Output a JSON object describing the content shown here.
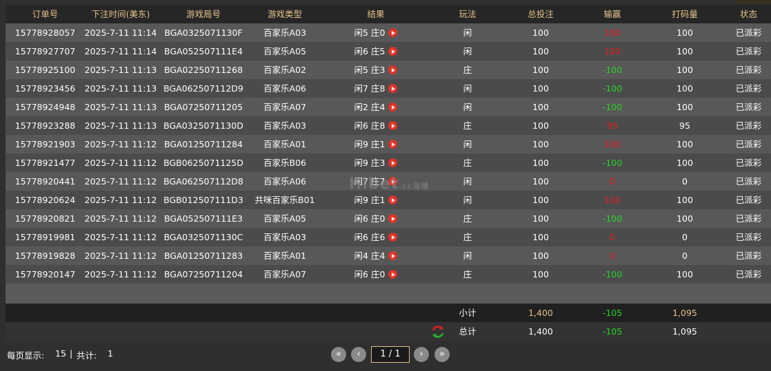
{
  "columns": [
    "订单号",
    "下注时间(美东)",
    "游戏局号",
    "游戏类型",
    "结果",
    "玩法",
    "总投注",
    "输赢",
    "打码量",
    "状态"
  ],
  "rows": [
    {
      "order": "15778928057",
      "time": "2025-7-11 11:14",
      "round": "BGA0325071130F",
      "game": "百家乐A03",
      "result": "闲5 庄0",
      "play": "闲",
      "bet": "100",
      "win": "100",
      "win_color": "red",
      "turnover": "100",
      "status": "已派彩"
    },
    {
      "order": "15778927707",
      "time": "2025-7-11 11:14",
      "round": "BGA052507111E4",
      "game": "百家乐A05",
      "result": "闲6 庄5",
      "play": "闲",
      "bet": "100",
      "win": "100",
      "win_color": "red",
      "turnover": "100",
      "status": "已派彩"
    },
    {
      "order": "15778925100",
      "time": "2025-7-11 11:13",
      "round": "BGA02250711268",
      "game": "百家乐A02",
      "result": "闲5 庄3",
      "play": "庄",
      "bet": "100",
      "win": "-100",
      "win_color": "green",
      "turnover": "100",
      "status": "已派彩"
    },
    {
      "order": "15778923456",
      "time": "2025-7-11 11:13",
      "round": "BGA062507112D9",
      "game": "百家乐A06",
      "result": "闲7 庄8",
      "play": "闲",
      "bet": "100",
      "win": "-100",
      "win_color": "green",
      "turnover": "100",
      "status": "已派彩"
    },
    {
      "order": "15778924948",
      "time": "2025-7-11 11:13",
      "round": "BGA07250711205",
      "game": "百家乐A07",
      "result": "闲2 庄4",
      "play": "闲",
      "bet": "100",
      "win": "-100",
      "win_color": "green",
      "turnover": "100",
      "status": "已派彩"
    },
    {
      "order": "15778923288",
      "time": "2025-7-11 11:13",
      "round": "BGA0325071130D",
      "game": "百家乐A03",
      "result": "闲6 庄8",
      "play": "庄",
      "bet": "100",
      "win": "95",
      "win_color": "red",
      "turnover": "95",
      "status": "已派彩"
    },
    {
      "order": "15778921903",
      "time": "2025-7-11 11:12",
      "round": "BGA01250711284",
      "game": "百家乐A01",
      "result": "闲9 庄1",
      "play": "闲",
      "bet": "100",
      "win": "100",
      "win_color": "red",
      "turnover": "100",
      "status": "已派彩"
    },
    {
      "order": "15778921477",
      "time": "2025-7-11 11:12",
      "round": "BGB0625071125D",
      "game": "百家乐B06",
      "result": "闲9 庄3",
      "play": "庄",
      "bet": "100",
      "win": "-100",
      "win_color": "green",
      "turnover": "100",
      "status": "已派彩"
    },
    {
      "order": "15778920441",
      "time": "2025-7-11 11:12",
      "round": "BGA062507112D8",
      "game": "百家乐A06",
      "result": "闲7 庄7",
      "play": "闲",
      "bet": "100",
      "win": "0",
      "win_color": "red",
      "turnover": "0",
      "status": "已派彩"
    },
    {
      "order": "15778920624",
      "time": "2025-7-11 11:12",
      "round": "BGB012507111D3",
      "game": "共咪百家乐B01",
      "result": "闲9 庄1",
      "play": "闲",
      "bet": "100",
      "win": "100",
      "win_color": "red",
      "turnover": "100",
      "status": "已派彩"
    },
    {
      "order": "15778920821",
      "time": "2025-7-11 11:12",
      "round": "BGA052507111E3",
      "game": "百家乐A05",
      "result": "闲6 庄0",
      "play": "庄",
      "bet": "100",
      "win": "-100",
      "win_color": "green",
      "turnover": "100",
      "status": "已派彩"
    },
    {
      "order": "15778919981",
      "time": "2025-7-11 11:12",
      "round": "BGA0325071130C",
      "game": "百家乐A03",
      "result": "闲6 庄6",
      "play": "庄",
      "bet": "100",
      "win": "0",
      "win_color": "red",
      "turnover": "0",
      "status": "已派彩"
    },
    {
      "order": "15778919828",
      "time": "2025-7-11 11:12",
      "round": "BGA01250711283",
      "game": "百家乐A01",
      "result": "闲4 庄4",
      "play": "闲",
      "bet": "100",
      "win": "0",
      "win_color": "red",
      "turnover": "0",
      "status": "已派彩"
    },
    {
      "order": "15778920147",
      "time": "2025-7-11 11:12",
      "round": "BGA07250711204",
      "game": "百家乐A07",
      "result": "闲6 庄0",
      "play": "庄",
      "bet": "100",
      "win": "-100",
      "win_color": "green",
      "turnover": "100",
      "status": "已派彩"
    }
  ],
  "subtotal": {
    "label": "小计",
    "bet": "1,400",
    "win": "-105",
    "turnover": "1,095"
  },
  "total": {
    "label": "总计",
    "bet": "1,400",
    "win": "-105",
    "turnover": "1,095"
  },
  "footer": {
    "per_page_label": "每页显示:",
    "per_page": "15",
    "separator": "|",
    "total_label": "共计:",
    "total": "1"
  },
  "pager": {
    "page": "1 / 1"
  },
  "watermark": {
    "main": "Hibet",
    "sub": ".cc",
    "cn": "海博"
  },
  "colors": {
    "header_text": "#e7c38a",
    "loss": "#28d428",
    "win": "#e02020",
    "accent": "#e7c38a"
  }
}
